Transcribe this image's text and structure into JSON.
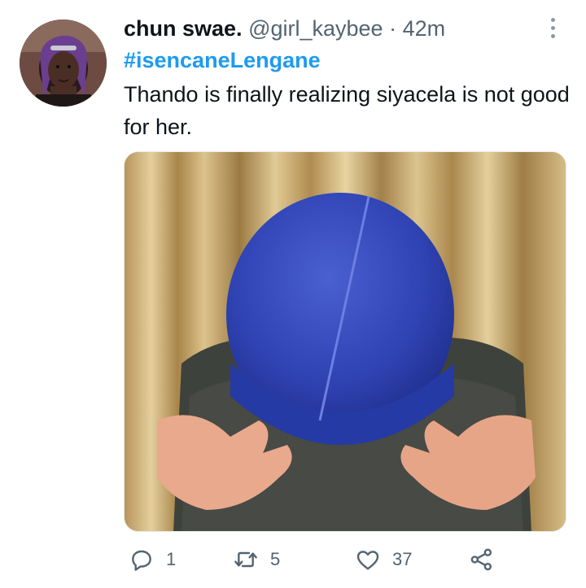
{
  "tweet": {
    "author": {
      "display_name": "chun swae.",
      "handle": "@girl_kaybee",
      "separator": "·",
      "time_ago": "42m"
    },
    "hashtag": "#isencaneLengane",
    "text": "Thando is finally realizing siyacela is not good for her.",
    "actions": {
      "reply_count": "1",
      "retweet_count": "5",
      "like_count": "37"
    },
    "icons": [
      "more-options-icon",
      "reply-icon",
      "retweet-icon",
      "like-icon",
      "share-icon"
    ],
    "colors": {
      "link": "#1d9bf0",
      "secondary_text": "#536471",
      "primary_text": "#0f1419"
    }
  }
}
